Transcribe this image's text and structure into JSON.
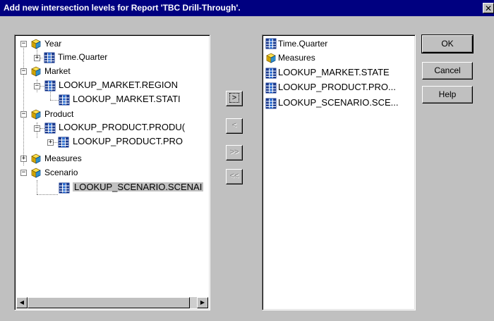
{
  "dialog": {
    "title": "Add new intersection levels for Report 'TBC Drill-Through'.",
    "close_glyph": "✕"
  },
  "tree": {
    "items": [
      {
        "label": "Year",
        "icon": "cube-icon",
        "expander": "−",
        "selected": false
      },
      {
        "label": "Time.Quarter",
        "icon": "level-table-icon",
        "expander": "+",
        "selected": false
      },
      {
        "label": "Market",
        "icon": "cube-icon",
        "expander": "−",
        "selected": false
      },
      {
        "label": "LOOKUP_MARKET.REGION",
        "icon": "level-table-icon",
        "expander": "−",
        "selected": false
      },
      {
        "label": "LOOKUP_MARKET.STATI",
        "icon": "level-table-icon",
        "expander": "",
        "selected": false
      },
      {
        "label": "Product",
        "icon": "cube-icon",
        "expander": "−",
        "selected": false
      },
      {
        "label": "LOOKUP_PRODUCT.PRODU(",
        "icon": "level-table-icon",
        "expander": "−",
        "selected": false
      },
      {
        "label": "LOOKUP_PRODUCT.PRO",
        "icon": "level-table-icon",
        "expander": "+",
        "selected": false
      },
      {
        "label": "Measures",
        "icon": "cube-icon",
        "expander": "+",
        "selected": false
      },
      {
        "label": "Scenario",
        "icon": "cube-icon",
        "expander": "−",
        "selected": false
      },
      {
        "label": "LOOKUP_SCENARIO.SCENAI",
        "icon": "level-table-icon",
        "expander": "",
        "selected": true
      }
    ],
    "scroll_left_glyph": "◀",
    "scroll_right_glyph": "▶"
  },
  "move_buttons": {
    "add": ">",
    "remove": "<",
    "add_all": ">>",
    "remove_all": "<<"
  },
  "selected_list": {
    "items": [
      {
        "label": "Time.Quarter",
        "icon": "level-table-icon"
      },
      {
        "label": "Measures",
        "icon": "cube-icon"
      },
      {
        "label": "LOOKUP_MARKET.STATE",
        "icon": "level-table-icon"
      },
      {
        "label": "LOOKUP_PRODUCT.PRO...",
        "icon": "level-table-icon"
      },
      {
        "label": "LOOKUP_SCENARIO.SCE...",
        "icon": "level-table-icon"
      }
    ]
  },
  "buttons": {
    "ok": "OK",
    "cancel": "Cancel",
    "help": "Help"
  },
  "colors": {
    "titlebar": "#000080",
    "face": "#c0c0c0",
    "cube_icon": "#ffd700",
    "table_icon": "#1a3a8f"
  }
}
